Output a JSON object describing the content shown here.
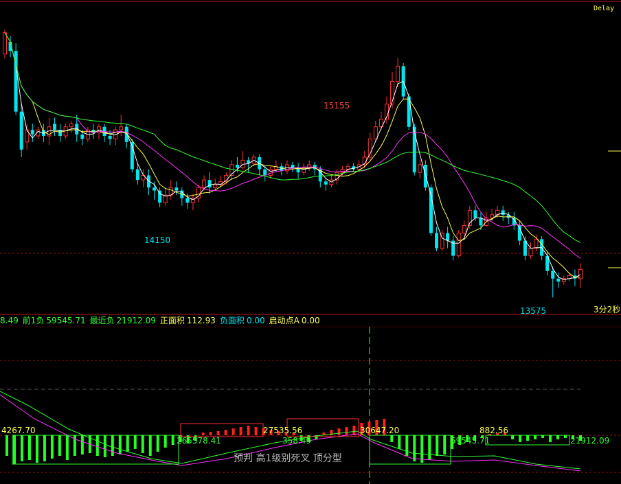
{
  "header": {
    "delay_label": "Delay"
  },
  "colors": {
    "up": "#ff3232",
    "down": "#00e5ee",
    "ma_fast": "#ffffff",
    "ma_mid": "#ffff55",
    "ma_slow1": "#ff33ff",
    "ma_slow2": "#33ff33",
    "grid": "#a01010",
    "hist_pos": "#ff2020",
    "hist_neg": "#22ff22"
  },
  "main_panel": {
    "price_labels": {
      "high": "15155",
      "low1": "14150",
      "low2": "13575"
    },
    "timeframe": "3分2秒"
  },
  "info_bar": {
    "prev_value": "8.49",
    "prev1_neg_label": "前1负",
    "prev1_neg_value": "59545.71",
    "recent_neg_label": "最近负",
    "recent_neg_value": "21912.09",
    "pos_area_label": "正面积",
    "pos_area_value": "112.93",
    "neg_area_label": "负面积",
    "neg_area_value": "0.00",
    "start_label": "启动点A",
    "start_value": "0.00"
  },
  "indicator_panel": {
    "labels": [
      "4267.70",
      "265578.41",
      "27535.56",
      "358.49",
      "30647.20",
      "59545.71",
      "882.56",
      "21912.09"
    ],
    "watermark": "预判  高1级别死叉  顶分型"
  },
  "chart_data": {
    "type": "candlestick",
    "title": "",
    "ylim": [
      13500,
      15400
    ],
    "price_marks": {
      "high": 15155,
      "low": 14150,
      "low2": 13575
    },
    "candles": [
      [
        15180,
        15320,
        15150,
        15340
      ],
      [
        15260,
        15200,
        15160,
        15300
      ],
      [
        15200,
        14800,
        14780,
        15250
      ],
      [
        14800,
        14550,
        14500,
        14850
      ],
      [
        14600,
        14680,
        14550,
        14720
      ],
      [
        14680,
        14650,
        14600,
        14720
      ],
      [
        14640,
        14680,
        14620,
        14700
      ],
      [
        14680,
        14640,
        14600,
        14720
      ],
      [
        14640,
        14700,
        14580,
        14760
      ],
      [
        14720,
        14680,
        14640,
        14760
      ],
      [
        14680,
        14640,
        14600,
        14720
      ],
      [
        14640,
        14700,
        14620,
        14720
      ],
      [
        14700,
        14720,
        14660,
        14740
      ],
      [
        14720,
        14650,
        14600,
        14780
      ],
      [
        14650,
        14620,
        14580,
        14680
      ],
      [
        14620,
        14680,
        14600,
        14700
      ],
      [
        14680,
        14660,
        14620,
        14720
      ],
      [
        14660,
        14700,
        14620,
        14720
      ],
      [
        14700,
        14640,
        14600,
        14720
      ],
      [
        14640,
        14620,
        14580,
        14680
      ],
      [
        14620,
        14680,
        14580,
        14700
      ],
      [
        14680,
        14700,
        14640,
        14780
      ],
      [
        14700,
        14600,
        14560,
        14720
      ],
      [
        14600,
        14420,
        14400,
        14620
      ],
      [
        14420,
        14350,
        14320,
        14460
      ],
      [
        14350,
        14380,
        14300,
        14420
      ],
      [
        14380,
        14300,
        14250,
        14420
      ],
      [
        14300,
        14280,
        14220,
        14340
      ],
      [
        14280,
        14200,
        14170,
        14300
      ],
      [
        14200,
        14250,
        14180,
        14300
      ],
      [
        14250,
        14300,
        14220,
        14350
      ],
      [
        14300,
        14280,
        14250,
        14340
      ],
      [
        14280,
        14230,
        14180,
        14300
      ],
      [
        14230,
        14200,
        14160,
        14260
      ],
      [
        14200,
        14230,
        14150,
        14260
      ],
      [
        14230,
        14300,
        14200,
        14320
      ],
      [
        14300,
        14350,
        14280,
        14380
      ],
      [
        14350,
        14300,
        14260,
        14400
      ],
      [
        14300,
        14320,
        14280,
        14360
      ],
      [
        14320,
        14340,
        14300,
        14380
      ],
      [
        14340,
        14380,
        14320,
        14400
      ],
      [
        14380,
        14450,
        14350,
        14480
      ],
      [
        14450,
        14430,
        14400,
        14500
      ],
      [
        14430,
        14480,
        14420,
        14540
      ],
      [
        14480,
        14460,
        14400,
        14500
      ],
      [
        14460,
        14500,
        14440,
        14520
      ],
      [
        14500,
        14420,
        14380,
        14520
      ],
      [
        14420,
        14380,
        14340,
        14440
      ],
      [
        14380,
        14420,
        14360,
        14440
      ],
      [
        14420,
        14440,
        14400,
        14480
      ],
      [
        14440,
        14410,
        14380,
        14460
      ],
      [
        14410,
        14450,
        14390,
        14480
      ],
      [
        14450,
        14430,
        14400,
        14470
      ],
      [
        14430,
        14400,
        14360,
        14460
      ],
      [
        14400,
        14430,
        14380,
        14460
      ],
      [
        14430,
        14450,
        14410,
        14480
      ],
      [
        14450,
        14420,
        14380,
        14470
      ],
      [
        14420,
        14340,
        14300,
        14440
      ],
      [
        14340,
        14320,
        14280,
        14360
      ],
      [
        14320,
        14350,
        14300,
        14380
      ],
      [
        14350,
        14400,
        14320,
        14420
      ],
      [
        14400,
        14420,
        14380,
        14440
      ],
      [
        14420,
        14440,
        14400,
        14460
      ],
      [
        14440,
        14420,
        14400,
        14460
      ],
      [
        14420,
        14450,
        14400,
        14480
      ],
      [
        14450,
        14500,
        14430,
        14540
      ],
      [
        14500,
        14620,
        14480,
        14660
      ],
      [
        14620,
        14700,
        14600,
        14740
      ],
      [
        14700,
        14750,
        14680,
        14800
      ],
      [
        14750,
        14850,
        14720,
        14900
      ],
      [
        14850,
        15000,
        14820,
        15060
      ],
      [
        15000,
        15100,
        14960,
        15155
      ],
      [
        15100,
        14900,
        14880,
        15120
      ],
      [
        14900,
        14700,
        14680,
        14920
      ],
      [
        14700,
        14400,
        14380,
        14720
      ],
      [
        14400,
        14450,
        14360,
        14480
      ],
      [
        14450,
        14300,
        14280,
        14480
      ],
      [
        14300,
        14000,
        13980,
        14320
      ],
      [
        14000,
        13900,
        13880,
        14040
      ],
      [
        13900,
        14000,
        13880,
        14020
      ],
      [
        14000,
        13950,
        13900,
        14040
      ],
      [
        13950,
        13850,
        13820,
        13980
      ],
      [
        13850,
        14000,
        13840,
        14020
      ],
      [
        14000,
        14050,
        13980,
        14080
      ],
      [
        14050,
        14150,
        14030,
        14180
      ],
      [
        14150,
        14100,
        14080,
        14180
      ],
      [
        14100,
        14050,
        14020,
        14140
      ],
      [
        14050,
        14100,
        14040,
        14140
      ],
      [
        14100,
        14120,
        14080,
        14160
      ],
      [
        14120,
        14150,
        14100,
        14180
      ],
      [
        14150,
        14120,
        14080,
        14180
      ],
      [
        14120,
        14100,
        14060,
        14140
      ],
      [
        14100,
        14050,
        14020,
        14140
      ],
      [
        14050,
        13950,
        13920,
        14080
      ],
      [
        13950,
        13850,
        13820,
        13980
      ],
      [
        13850,
        13900,
        13830,
        13940
      ],
      [
        13900,
        13960,
        13880,
        13990
      ],
      [
        13960,
        13850,
        13820,
        13980
      ],
      [
        13850,
        13750,
        13720,
        13880
      ],
      [
        13750,
        13700,
        13575,
        13780
      ],
      [
        13700,
        13680,
        13640,
        13740
      ],
      [
        13680,
        13700,
        13660,
        13720
      ],
      [
        13700,
        13720,
        13680,
        13740
      ],
      [
        13720,
        13700,
        13650,
        13760
      ],
      [
        13700,
        13760,
        13640,
        13800
      ]
    ]
  }
}
